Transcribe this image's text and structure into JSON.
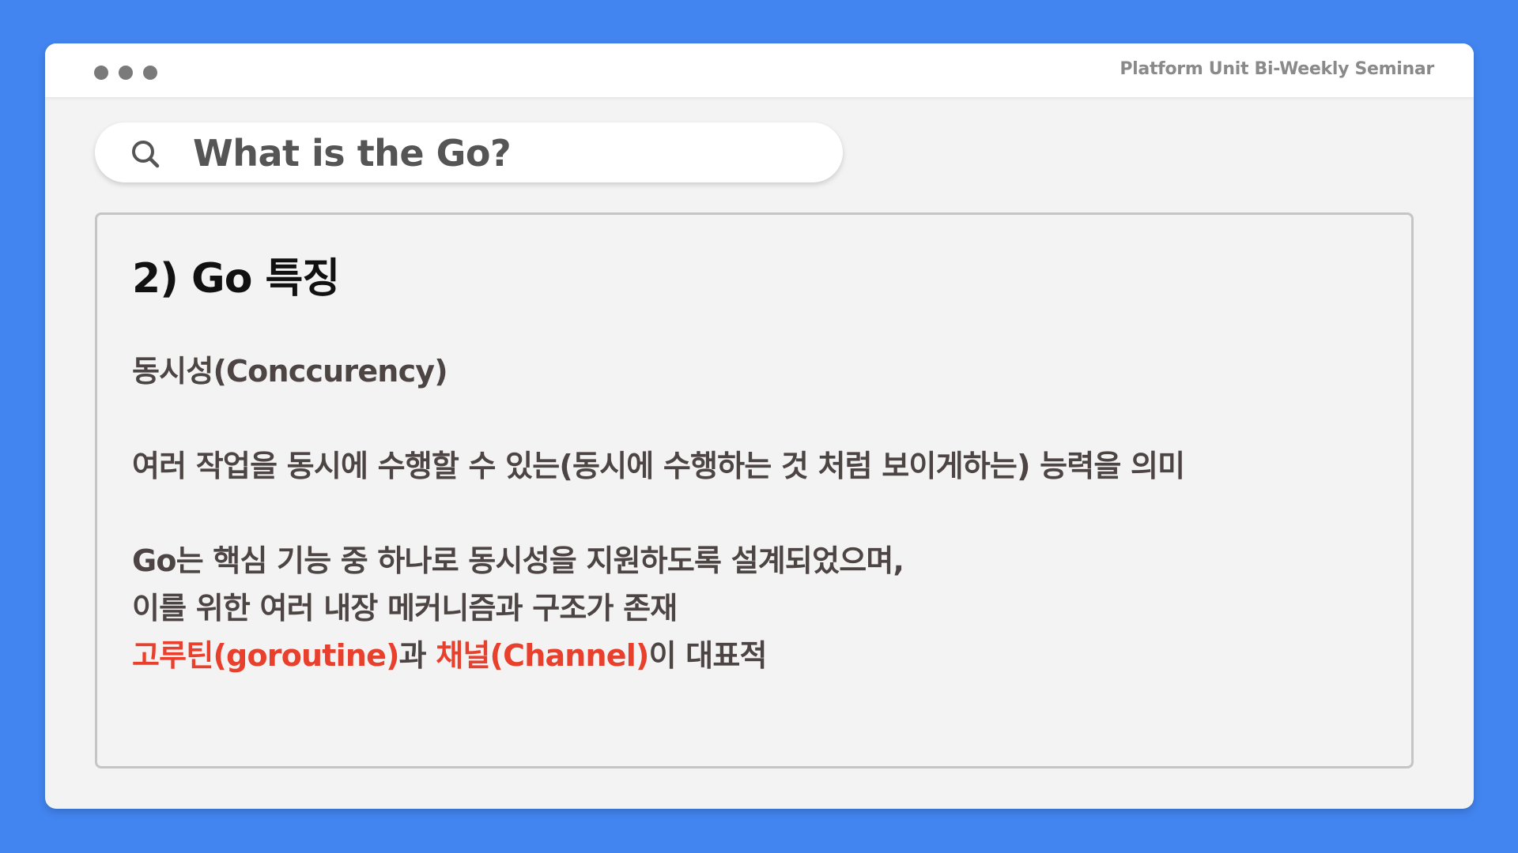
{
  "window": {
    "title": "Platform Unit Bi-Weekly Seminar"
  },
  "search": {
    "icon": "search-icon",
    "text": "What is the Go?"
  },
  "slide": {
    "heading": "2) Go 특징",
    "topic": "동시성(Conccurency)",
    "definition": "여러 작업을 동시에 수행할 수 있는(동시에 수행하는 것 처럼 보이게하는) 능력을 의미",
    "support_line1": "Go는 핵심 기능 중 하나로 동시성을 지원하도록 설계되었으며,",
    "support_line2": "이를 위한 여러 내장 메커니즘과 구조가 존재",
    "summary": {
      "goroutine": "고루틴(goroutine)",
      "connector": "과 ",
      "channel": "채널(Channel)",
      "tail": "이 대표적"
    }
  },
  "colors": {
    "background": "#4285f0",
    "highlight": "#e8402d",
    "text": "#4d4444"
  }
}
